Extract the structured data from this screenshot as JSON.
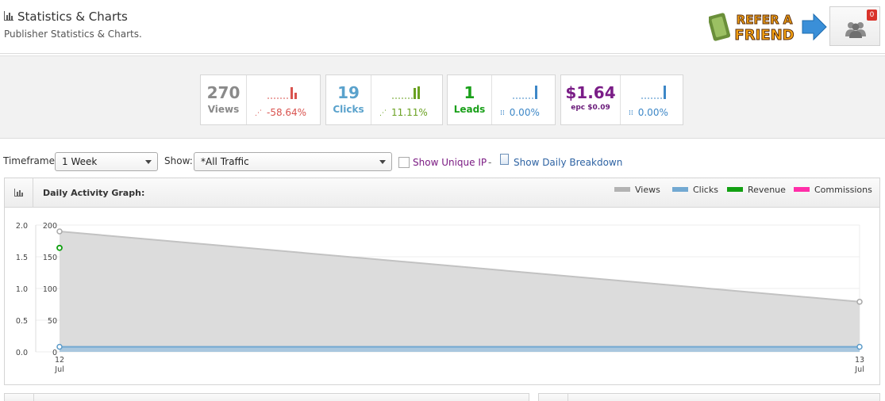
{
  "header": {
    "title": "Statistics & Charts",
    "subtitle": "Publisher Statistics & Charts.",
    "refer_line1": "REFER A",
    "refer_line2": "FRIEND",
    "user_badge": "0"
  },
  "stats": [
    {
      "value": "270",
      "label": "Views",
      "change": "-58.64%",
      "color": "#8a8a8a",
      "change_color": "#d9534f"
    },
    {
      "value": "19",
      "label": "Clicks",
      "change": "11.11%",
      "color": "#5aa2cc",
      "change_color": "#6aa121"
    },
    {
      "value": "1",
      "label": "Leads",
      "change": "0.00%",
      "color": "#1aa01a",
      "change_color": "#3d87c7"
    },
    {
      "value": "$1.64",
      "label": "epc",
      "epc": "$0.09",
      "change": "0.00%",
      "color": "#7a1d87",
      "change_color": "#3d87c7"
    }
  ],
  "filters": {
    "timeframe_label": "Timeframe:",
    "timeframe_value": "1 Week",
    "show_label": "Show:",
    "show_value": "*All Traffic",
    "unique_ip": "Show Unique IP",
    "separator": "-",
    "daily_breakdown": "Show Daily Breakdown"
  },
  "graph": {
    "title": "Daily Activity Graph:",
    "legend": [
      {
        "name": "Views",
        "color": "#b3b3b3"
      },
      {
        "name": "Clicks",
        "color": "#73a9d2"
      },
      {
        "name": "Revenue",
        "color": "#12a012"
      },
      {
        "name": "Commissions",
        "color": "#ff2ea8"
      }
    ]
  },
  "chart_data": {
    "type": "area",
    "x": [
      "12 Jul",
      "13 Jul"
    ],
    "x_ticks": [
      {
        "day": "12",
        "month": "Jul"
      },
      {
        "day": "13",
        "month": "Jul"
      }
    ],
    "y_left_ticks": [
      "2.0",
      "1.5",
      "1.0",
      "0.5",
      "0.0"
    ],
    "y_left_range": [
      0,
      2.0
    ],
    "y_right_ticks": [
      "200",
      "150",
      "100",
      "50",
      "0"
    ],
    "y_right_range": [
      0,
      200
    ],
    "series": [
      {
        "name": "Views",
        "axis": "right",
        "values": [
          190,
          79
        ]
      },
      {
        "name": "Clicks",
        "axis": "right",
        "values": [
          8,
          8
        ]
      },
      {
        "name": "Revenue",
        "axis": "left",
        "values": [
          1.64,
          null
        ]
      },
      {
        "name": "Commissions",
        "axis": "left",
        "values": [
          0,
          0
        ]
      }
    ],
    "grid": true
  }
}
